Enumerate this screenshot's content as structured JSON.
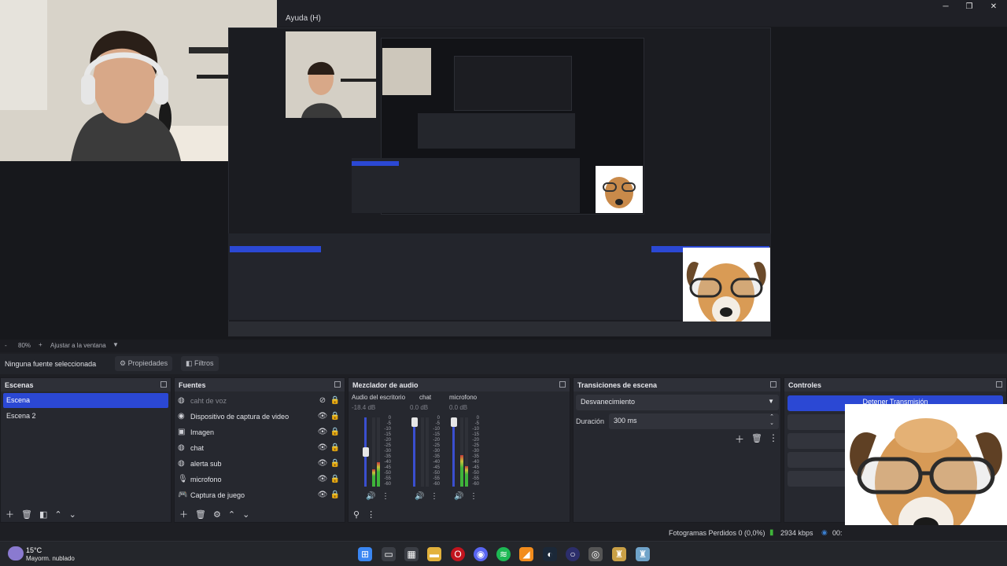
{
  "window": {
    "menu_help": "Ayuda (H)"
  },
  "zoom": {
    "level": "80%",
    "plus": "+",
    "fit_label": "Ajustar a la ventana",
    "minus": "-"
  },
  "properties_bar": {
    "no_source": "Ninguna fuente seleccionada",
    "properties": "Propiedades",
    "filters": "Filtros"
  },
  "scenes": {
    "title": "Escenas",
    "items": [
      {
        "label": "Escena",
        "selected": true
      },
      {
        "label": "Escena 2",
        "selected": false
      }
    ]
  },
  "sources": {
    "title": "Fuentes",
    "items": [
      {
        "label": "caht de voz",
        "icon": "browser-icon",
        "visible": false
      },
      {
        "label": "Dispositivo de captura de video",
        "icon": "camera-icon",
        "visible": true
      },
      {
        "label": "Imagen",
        "icon": "image-icon",
        "visible": true
      },
      {
        "label": "chat",
        "icon": "browser-icon",
        "visible": true
      },
      {
        "label": "alerta sub",
        "icon": "browser-icon",
        "visible": true
      },
      {
        "label": "microfono",
        "icon": "microphone-icon",
        "visible": true
      },
      {
        "label": "Captura de juego",
        "icon": "gamepad-icon",
        "visible": true
      }
    ]
  },
  "mixer": {
    "title": "Mezclador de audio",
    "channels": [
      {
        "name": "Audio del escritorio",
        "db": "-18.4 dB",
        "level": 0.35,
        "fader": 0.45
      },
      {
        "name": "chat",
        "db": "0.0 dB",
        "level": 0.0,
        "fader": 0.9
      },
      {
        "name": "microfono",
        "db": "0.0 dB",
        "level": 0.45,
        "fader": 0.9
      }
    ],
    "scale": [
      "0",
      "-5",
      "-10",
      "-15",
      "-20",
      "-25",
      "-30",
      "-35",
      "-40",
      "-45",
      "-50",
      "-55",
      "-60"
    ]
  },
  "transitions": {
    "title": "Transiciones de escena",
    "selected": "Desvanecimiento",
    "duration_label": "Duración",
    "duration_value": "300 ms"
  },
  "controls": {
    "title": "Controles",
    "stop_stream": "Detener Transmisión"
  },
  "status": {
    "dropped_frames": "Fotogramas Perdidos 0 (0,0%)",
    "bitrate": "2934 kbps",
    "time": "00:"
  },
  "taskbar": {
    "temp": "15°C",
    "weather": "Mayorm. nublado"
  },
  "colors": {
    "accent": "#2b48d4",
    "bg": "#1e1f24",
    "dock": "#26282f"
  }
}
